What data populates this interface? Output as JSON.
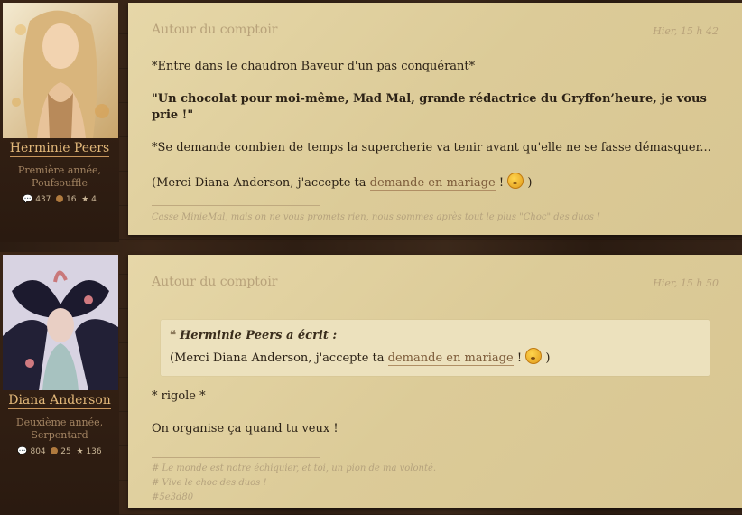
{
  "posts": [
    {
      "user": {
        "name": "Herminie Peers",
        "rank_line1": "Première année,",
        "rank_line2": "Poufsouffle",
        "stat_messages": "437",
        "stat_coins": "16",
        "stat_stars": "4"
      },
      "title": "Autour du comptoir",
      "date": "Hier, 15 h 42",
      "line1": "*Entre dans le chaudron Baveur d'un pas conquérant*",
      "line2": "\"Un chocolat pour moi-même, Mad Mal, grande rédactrice du Gryffon’heure, je vous prie !\"",
      "line3": "*Se demande combien de temps la supercherie va tenir avant qu'elle ne se fasse démasquer...",
      "line4_pre": "(Merci Diana Anderson, j'accepte ta ",
      "line4_link": "demande en mariage",
      "line4_post": " !",
      "line4_end": " )",
      "signature": "Casse MinieMal, mais on ne vous promets rien, nous sommes après tout le plus \"Choc\" des duos !"
    },
    {
      "user": {
        "name": "Diana Anderson",
        "rank_line1": "Deuxième année,",
        "rank_line2": "Serpentard",
        "stat_messages": "804",
        "stat_coins": "25",
        "stat_stars": "136"
      },
      "title": "Autour du comptoir",
      "date": "Hier, 15 h 50",
      "quote_author": "Herminie Peers a écrit :",
      "quote_pre": "(Merci Diana Anderson, j'accepte ta ",
      "quote_link": "demande en mariage",
      "quote_post": " !",
      "quote_end": " )",
      "line1": "* rigole *",
      "line2": "On organise ça quand tu veux !",
      "sig1": "# Le monde est notre échiquier, et toi, un pion de ma volonté.",
      "sig2": "# Vive le choc des duos !",
      "sig3": "#5e3d80"
    }
  ],
  "colors": {
    "parchment": "#e0d09f",
    "username": "#e2b87a",
    "link": "#7d5c3a"
  },
  "icons": {
    "messages": "speech-bubble-icon",
    "coins": "coin-icon",
    "stars": "star-icon",
    "quote": "quote-mark-icon",
    "emoji": "smiley-emoji-icon"
  }
}
